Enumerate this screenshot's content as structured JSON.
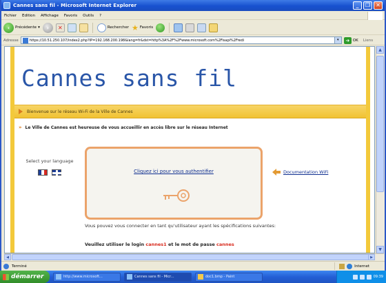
{
  "window": {
    "title": "Cannes sans fil - Microsoft Internet Explorer",
    "buttons": [
      "_",
      "❐",
      "✕"
    ]
  },
  "menu": [
    "Fichier",
    "Edition",
    "Affichage",
    "Favoris",
    "Outils",
    "?"
  ],
  "toolbar": {
    "back_label": "Précédente",
    "search_label": "Rechercher",
    "favorites_label": "Favoris"
  },
  "address": {
    "label": "Adresse",
    "url": "https://10.51.250.107/index2.php?IP=192.168.200.198&lang=fr&dst=http%3A%2F%2Fwww.microsoft.com%2Fisapi%2Fredi",
    "go_label": "OK",
    "links_label": "Liens"
  },
  "page": {
    "site_title": "Cannes sans fil",
    "welcome": "Bienvenue sur le réseau Wi-Fi de la Ville de Cannes",
    "intro": "Le Ville de Cannes est heureuse de vous accueillir en accès libre sur le réseau Internet",
    "language_label": "Select your language",
    "auth_link": "Cliquez ici pour vous authentifier",
    "doc_link": "Documentation WiFi",
    "spec_text": "Vous pouvez vous connecter en tant qu'utilisateur ayant les spécifications suivantes:",
    "login_prefix": "Veuillez utiliser le login ",
    "login_value": "cannes1",
    "login_middle": " et le mot de passe ",
    "password_value": "cannes"
  },
  "status": {
    "text": "Terminé",
    "zone": "Internet"
  },
  "taskbar": {
    "start_label": "démarrer",
    "tasks": [
      "http://www.microsoft...",
      "Cannes sans fil - Micr...",
      "doc1.bmp - Paint"
    ],
    "clock": "09:39"
  },
  "colors": {
    "accent_yellow": "#f3c93b",
    "title_blue": "#2a56a8",
    "auth_border": "#eba36a",
    "password_red": "#d8291c"
  }
}
